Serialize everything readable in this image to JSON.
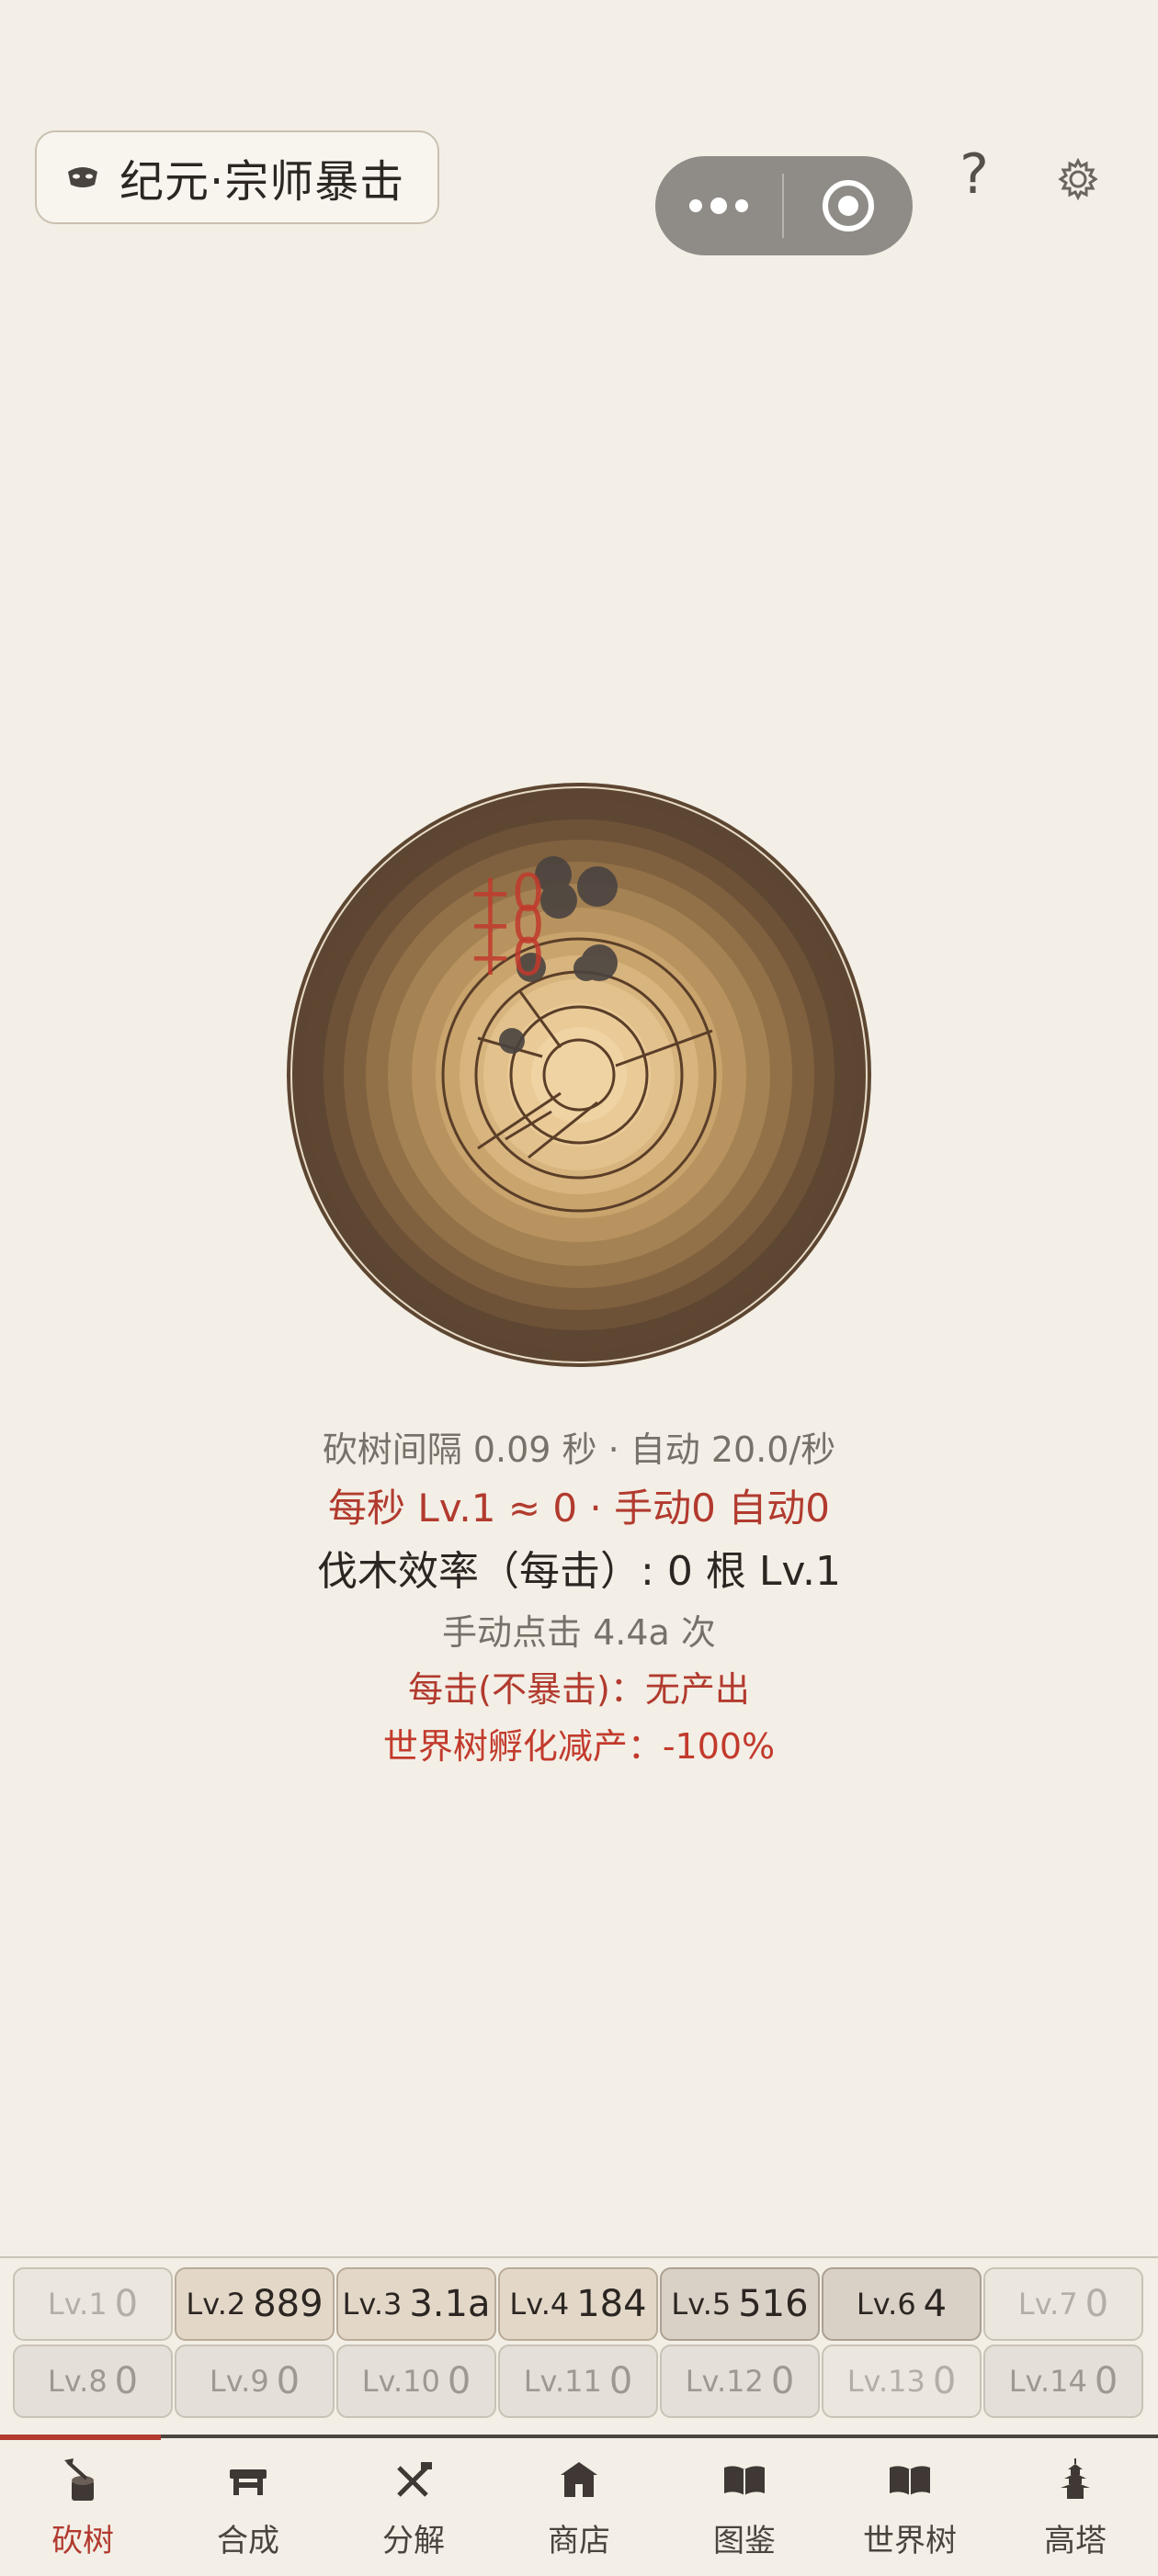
{
  "header": {
    "era_icon": "mask-icon",
    "era_title": "纪元·宗师暴击",
    "help_label": "?",
    "settings_icon": "gear-icon"
  },
  "stump": {
    "floating_texts": [
      "+0",
      "+0",
      "+0"
    ]
  },
  "stats": {
    "interval": "砍树间隔 0.09 秒 · 自动 20.0/秒",
    "per_second": "每秒 Lv.1 ≈ 0 · 手动0 自动0",
    "efficiency": "伐木效率（每击）: 0 根 Lv.1",
    "manual_clicks": "手动点击 4.4a 次",
    "per_hit": "每击(不暴击)：无产出",
    "world_tree": "世界树孵化减产：-100%"
  },
  "levels": [
    {
      "name": "Lv.1",
      "count": "0"
    },
    {
      "name": "Lv.2",
      "count": "889"
    },
    {
      "name": "Lv.3",
      "count": "3.1a"
    },
    {
      "name": "Lv.4",
      "count": "184"
    },
    {
      "name": "Lv.5",
      "count": "516"
    },
    {
      "name": "Lv.6",
      "count": "4"
    },
    {
      "name": "Lv.7",
      "count": "0"
    },
    {
      "name": "Lv.8",
      "count": "0"
    },
    {
      "name": "Lv.9",
      "count": "0"
    },
    {
      "name": "Lv.10",
      "count": "0"
    },
    {
      "name": "Lv.11",
      "count": "0"
    },
    {
      "name": "Lv.12",
      "count": "0"
    },
    {
      "name": "Lv.13",
      "count": "0"
    },
    {
      "name": "Lv.14",
      "count": "0"
    }
  ],
  "tabs": [
    {
      "label": "砍树",
      "icon": "axe-stump-icon",
      "active": true
    },
    {
      "label": "合成",
      "icon": "workbench-icon",
      "active": false
    },
    {
      "label": "分解",
      "icon": "tools-icon",
      "active": false
    },
    {
      "label": "商店",
      "icon": "shop-icon",
      "active": false
    },
    {
      "label": "图鉴",
      "icon": "book-icon",
      "active": false
    },
    {
      "label": "世界树",
      "icon": "book-icon",
      "active": false
    },
    {
      "label": "高塔",
      "icon": "pagoda-icon",
      "active": false
    }
  ],
  "colors": {
    "background": "#f3efe6",
    "accent_red": "#b23a2e",
    "text_dark": "#2b2622",
    "text_muted": "#77716a"
  }
}
